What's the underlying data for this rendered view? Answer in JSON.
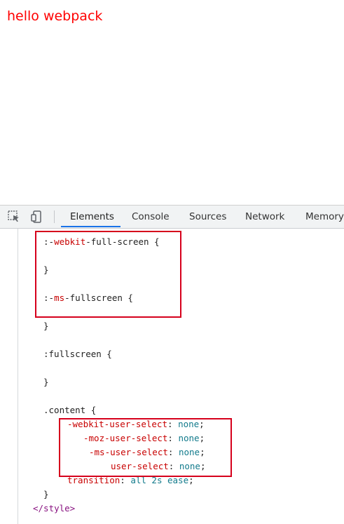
{
  "page": {
    "heading": "hello webpack",
    "heading_color": "#ff0000"
  },
  "devtools": {
    "toolbar": {
      "icons": [
        "inspect-element-icon",
        "device-toolbar-icon"
      ],
      "tabs": [
        {
          "label": "Elements",
          "active": true
        },
        {
          "label": "Console",
          "active": false
        },
        {
          "label": "Sources",
          "active": false
        },
        {
          "label": "Network",
          "active": false
        },
        {
          "label": "Memory",
          "active": false
        }
      ],
      "active_tab_color": "#1a73e8"
    },
    "code": {
      "lines": [
        {
          "selector_prefix": ":-",
          "selector_vendor": "webkit",
          "selector_rest": "-full-screen {"
        },
        {
          "text": "}"
        },
        {
          "selector_prefix": ":-",
          "selector_vendor": "ms",
          "selector_rest": "-fullscreen {"
        },
        {
          "text": "}"
        },
        {
          "text": ":fullscreen {"
        },
        {
          "text": "}"
        },
        {
          "text": ".content {"
        },
        {
          "property": "-webkit-user-select",
          "value": "none"
        },
        {
          "property": "-moz-user-select",
          "value": "none"
        },
        {
          "property": "-ms-user-select",
          "value": "none"
        },
        {
          "property": "user-select",
          "value": "none"
        },
        {
          "property": "transition",
          "value": "all 2s ease"
        },
        {
          "text": "}"
        },
        {
          "tag": "</style>"
        }
      ]
    },
    "highlight_color": "#d6001c"
  }
}
